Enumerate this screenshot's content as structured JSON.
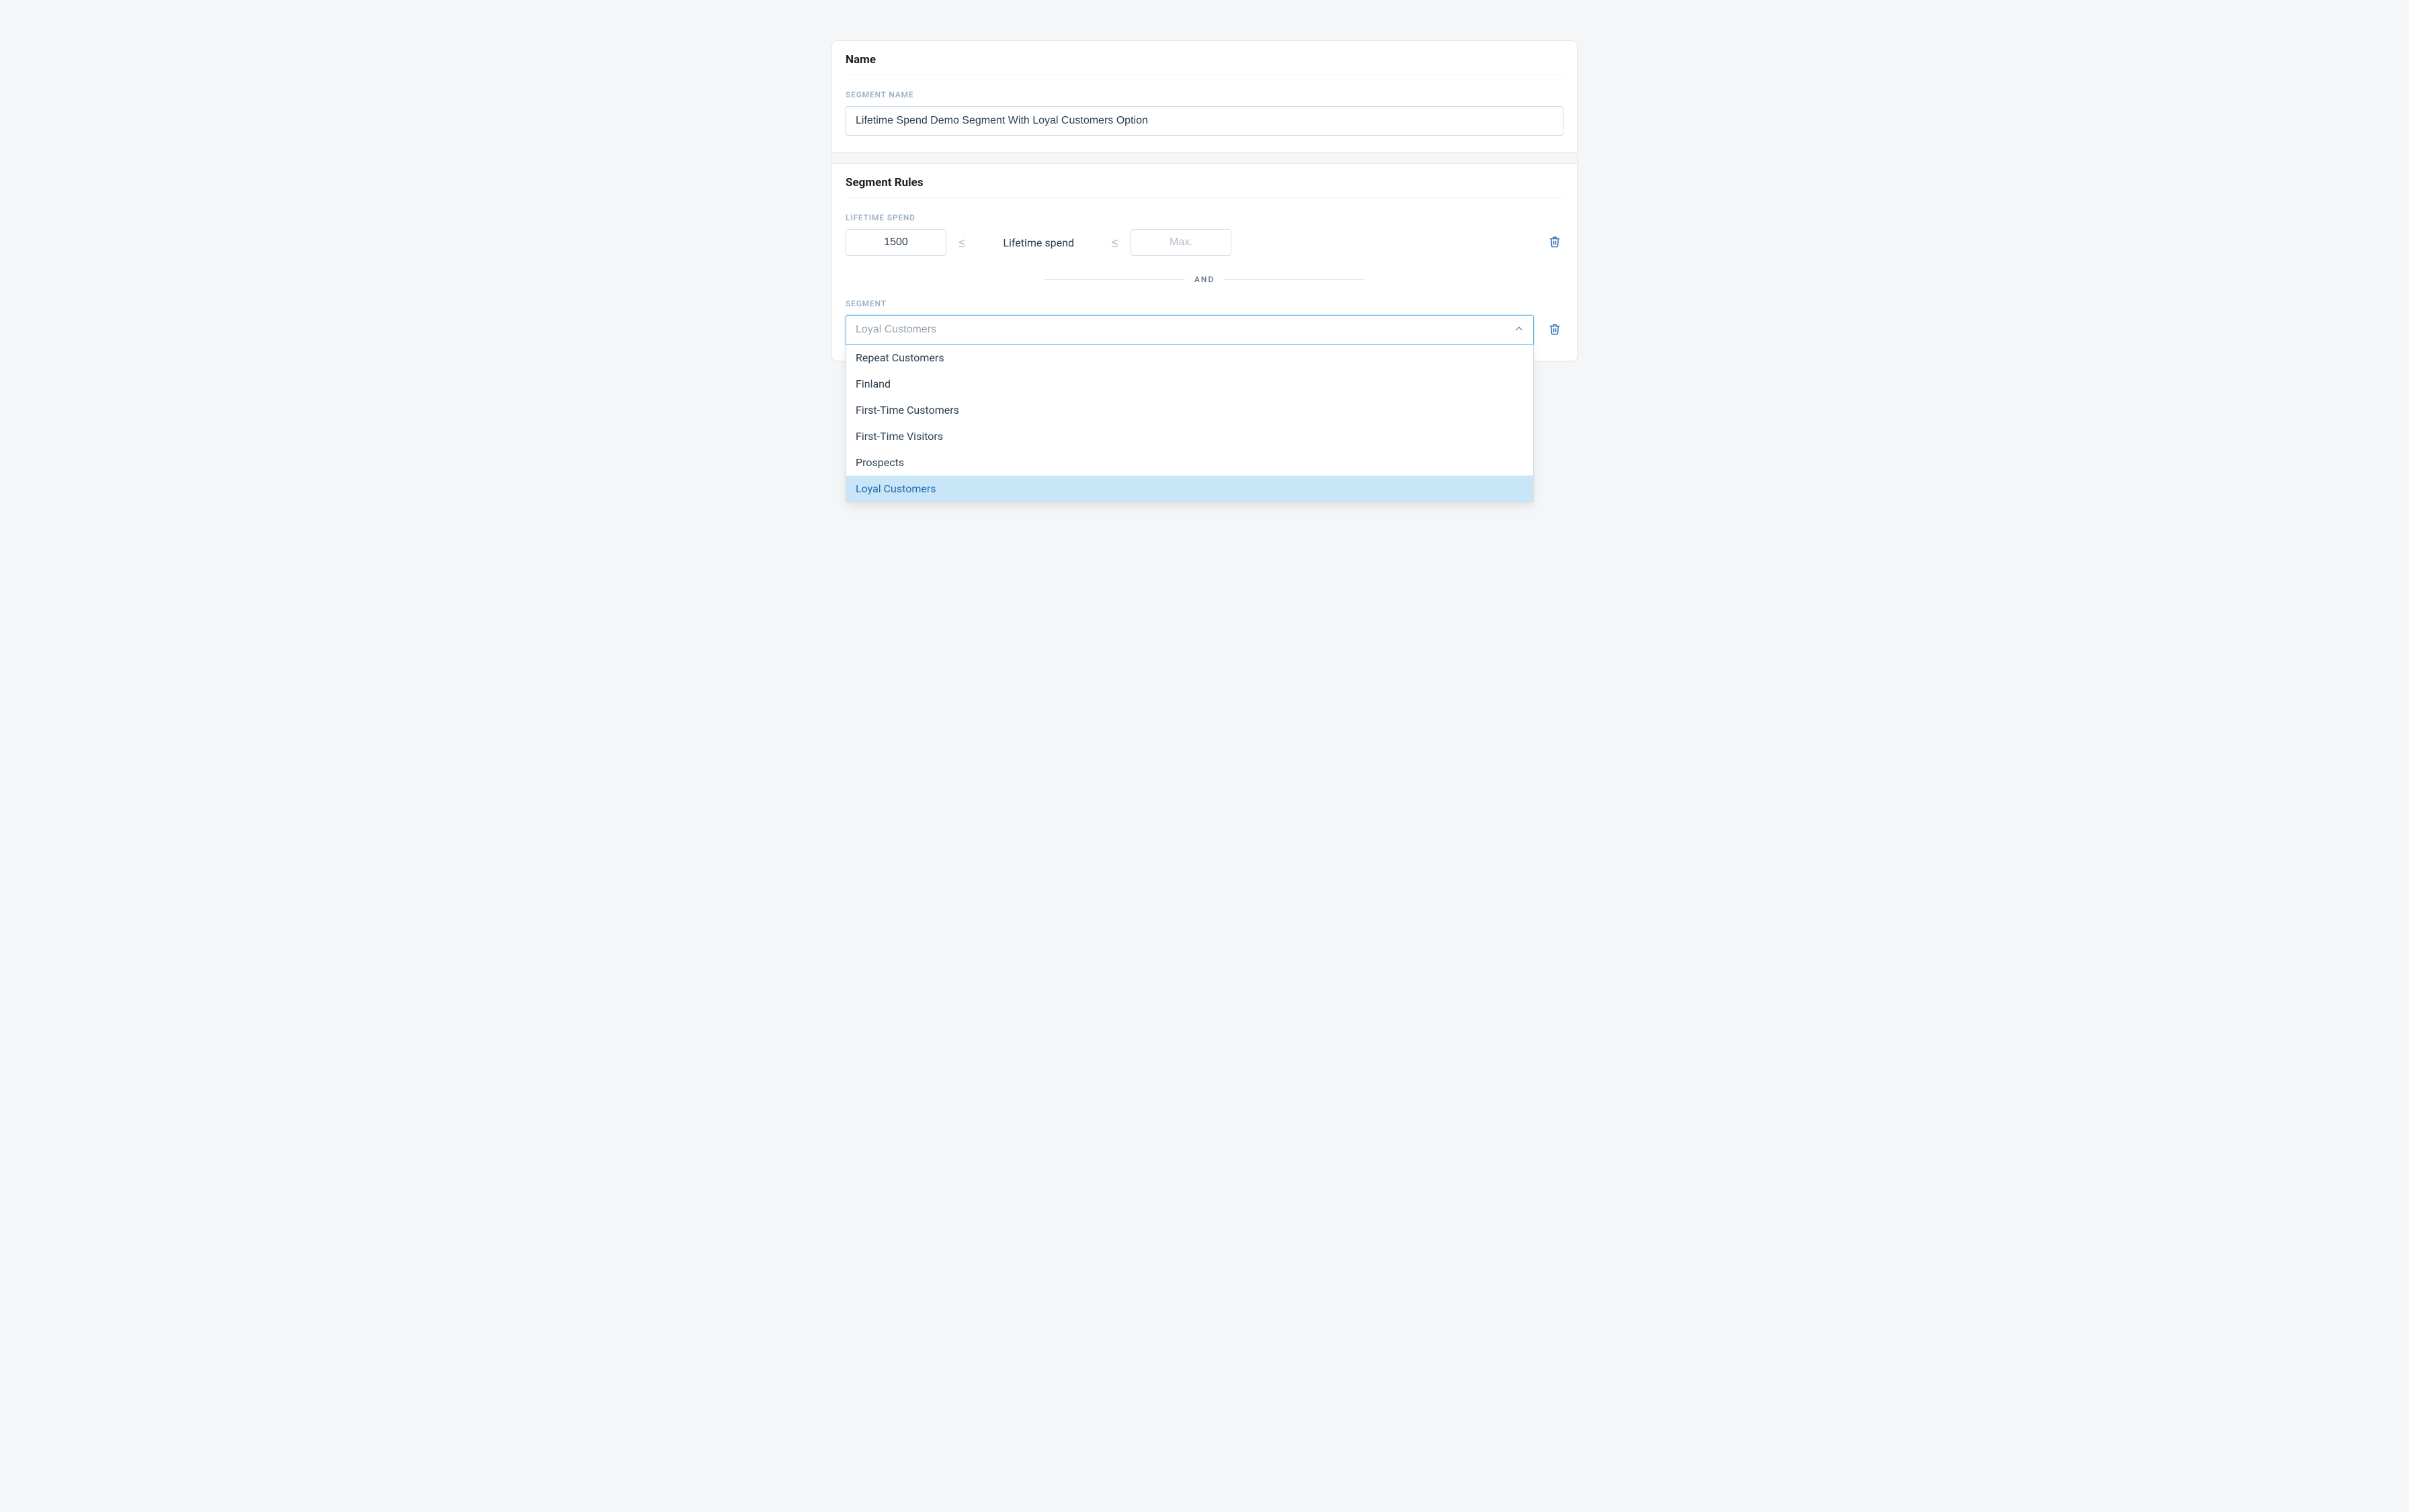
{
  "name_section": {
    "title": "Name",
    "field_label": "SEGMENT NAME",
    "value": "Lifetime Spend Demo Segment With Loyal Customers Option"
  },
  "rules_section": {
    "title": "Segment Rules",
    "lifetime_spend": {
      "label": "LIFETIME SPEND",
      "min_value": "1500",
      "lte": "≤",
      "rule_text": "Lifetime spend",
      "max_placeholder": "Max."
    },
    "and_label": "AND",
    "segment": {
      "label": "SEGMENT",
      "placeholder": "Loyal Customers",
      "options": [
        {
          "label": "Repeat Customers",
          "selected": false
        },
        {
          "label": "Finland",
          "selected": false
        },
        {
          "label": "First-Time Customers",
          "selected": false
        },
        {
          "label": "First-Time Visitors",
          "selected": false
        },
        {
          "label": "Prospects",
          "selected": false
        },
        {
          "label": "Loyal Customers",
          "selected": true
        }
      ]
    }
  }
}
